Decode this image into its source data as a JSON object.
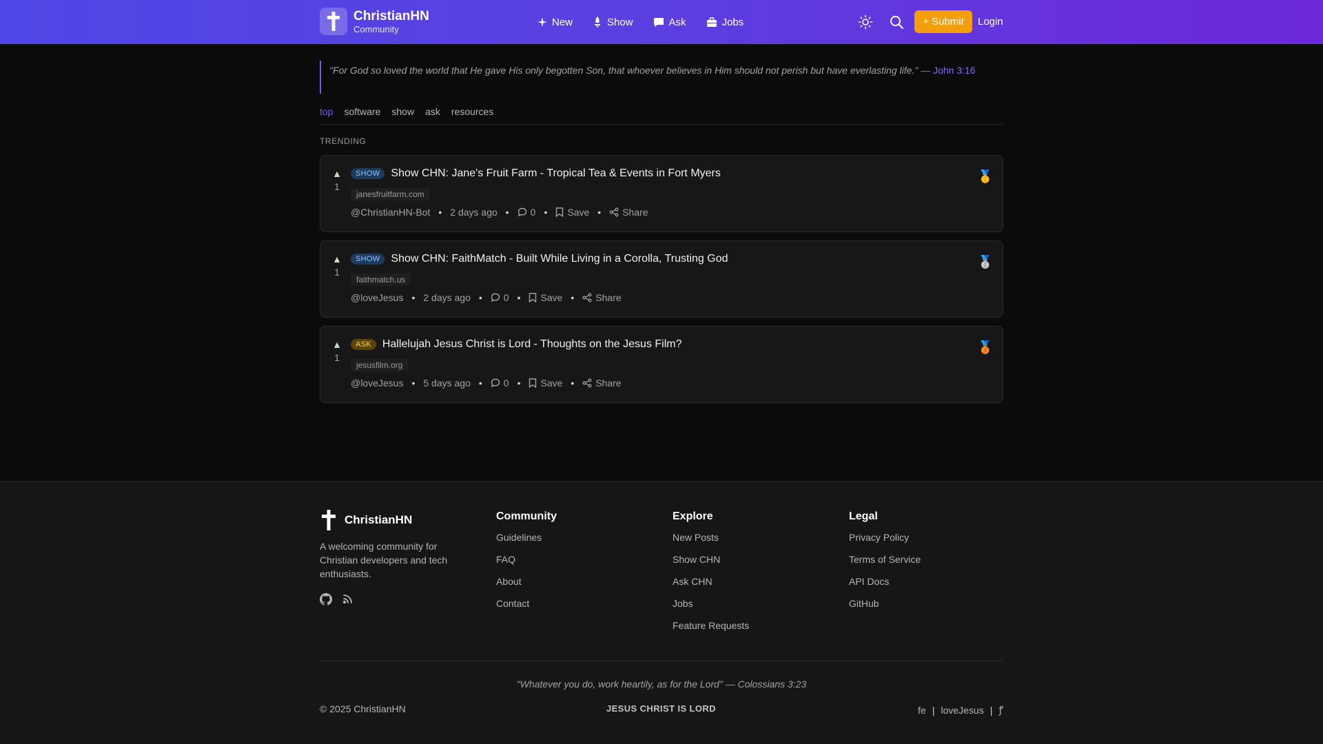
{
  "header": {
    "brand_name": "ChristianHN",
    "brand_sub": "Community",
    "nav": [
      {
        "label": "New",
        "icon": "sparkle-icon"
      },
      {
        "label": "Show",
        "icon": "rocket-icon"
      },
      {
        "label": "Ask",
        "icon": "chat-icon"
      },
      {
        "label": "Jobs",
        "icon": "briefcase-icon"
      }
    ],
    "submit_label": "+ Submit",
    "login_label": "Login",
    "gradient_start": "#4f46e5",
    "gradient_end": "#6d28d9",
    "submit_color": "#f59e0b"
  },
  "verse": {
    "text": "\"For God so loved the world that He gave His only begotten Son, that whoever believes in Him should not perish but have everlasting life.\"",
    "reference": "— John 3:16"
  },
  "tabs": [
    "top",
    "software",
    "show",
    "ask",
    "resources"
  ],
  "active_tab": "top",
  "section_label": "TRENDING",
  "posts": [
    {
      "votes": "1",
      "badge": "SHOW",
      "title": "Show CHN: Jane's Fruit Farm - Tropical Tea & Events in Fort Myers",
      "domain": "janesfruitfarm.com",
      "author": "@ChristianHN-Bot",
      "time": "2 days ago",
      "comments": "0",
      "save_label": "Save",
      "share_label": "Share",
      "medal": "🥇"
    },
    {
      "votes": "1",
      "badge": "SHOW",
      "title": "Show CHN: FaithMatch - Built While Living in a Corolla, Trusting God",
      "domain": "faithmatch.us",
      "author": "@loveJesus",
      "time": "2 days ago",
      "comments": "0",
      "save_label": "Save",
      "share_label": "Share",
      "medal": "🥈"
    },
    {
      "votes": "1",
      "badge": "ASK",
      "title": "Hallelujah Jesus Christ is Lord - Thoughts on the Jesus Film?",
      "domain": "jesusfilm.org",
      "author": "@loveJesus",
      "time": "5 days ago",
      "comments": "0",
      "save_label": "Save",
      "share_label": "Share",
      "medal": "🥉"
    }
  ],
  "footer": {
    "brand_name": "ChristianHN",
    "description": "A welcoming community for Christian developers and tech enthusiasts.",
    "columns": [
      {
        "title": "Community",
        "links": [
          "Guidelines",
          "FAQ",
          "About",
          "Contact"
        ]
      },
      {
        "title": "Explore",
        "links": [
          "New Posts",
          "Show CHN",
          "Ask CHN",
          "Jobs",
          "Feature Requests"
        ]
      },
      {
        "title": "Legal",
        "links": [
          "Privacy Policy",
          "Terms of Service",
          "API Docs",
          "GitHub"
        ]
      }
    ],
    "quote": "\"Whatever you do, work heartily, as for the Lord\" — Colossians 3:23",
    "copyright": "© 2025 ChristianHN",
    "center_text": "JESUS CHRIST IS LORD",
    "right_links": [
      "fe",
      "loveJesus",
      "ꝭ"
    ]
  }
}
